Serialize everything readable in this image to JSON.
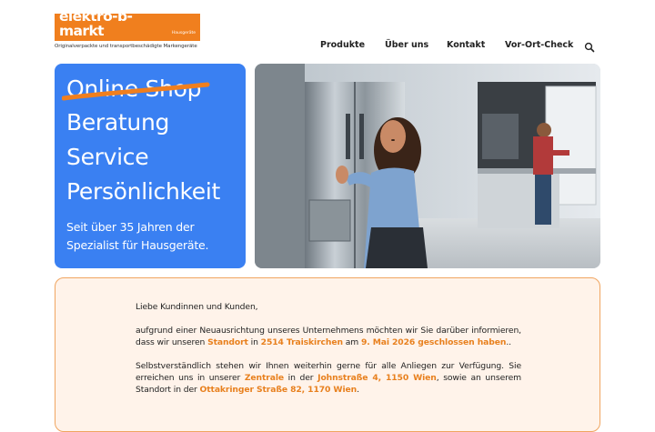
{
  "logo": {
    "name": "elektro-b-markt",
    "small": "Hausgeräte",
    "tagline": "Originalverpackte und transportbeschädigte Markengeräte"
  },
  "nav": {
    "items": [
      "Produkte",
      "Über uns",
      "Kontakt",
      "Vor-Ort-Check"
    ],
    "search_icon": "search-icon"
  },
  "hero": {
    "struck": "Online Shop",
    "lines": [
      "Beratung",
      "Service",
      "Persönlichkeit"
    ],
    "subtitle": "Seit über 35 Jahren der Spezialist für Hausgeräte."
  },
  "notice": {
    "greeting": "Liebe Kundinnen und Kunden,",
    "p1_a": "aufgrund einer Neuausrichtung unseres Unternehmens möchten wir Sie darüber informieren, dass wir unseren ",
    "p1_h1": "Standort",
    "p1_b": " in ",
    "p1_h2": "2514 Traiskirchen",
    "p1_c": " am ",
    "p1_h3": "9. Mai 2026 geschlossen haben",
    "p1_d": "..",
    "p2_a": "Selbstverständlich stehen wir Ihnen weiterhin gerne für alle Anliegen zur Verfügung. Sie erreichen uns in unserer ",
    "p2_h1": "Zentrale",
    "p2_b": " in der ",
    "p2_h2": "Johnstraße 4, 1150 Wien",
    "p2_c": ", sowie an unserem Standort in der ",
    "p2_h3": "Ottakringer Straße 82, 1170 Wien",
    "p2_d": "."
  },
  "colors": {
    "accent": "#f07f1e",
    "hero_blue": "#3a80f2",
    "strike": "#f07f1e",
    "notice_bg": "#fff3ea"
  }
}
